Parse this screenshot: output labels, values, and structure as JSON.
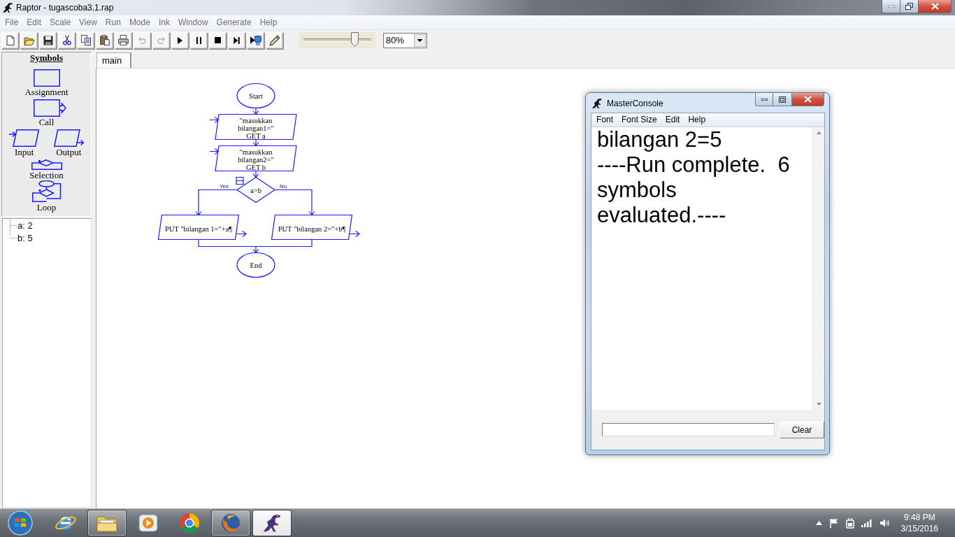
{
  "window": {
    "title": "Raptor - tugascoba3.1.rap"
  },
  "menu_bar": [
    "File",
    "Edit",
    "Scale",
    "View",
    "Run",
    "Mode",
    "Ink",
    "Window",
    "Generate",
    "Help"
  ],
  "toolbar": {
    "buttons": [
      {
        "kind": "new",
        "disabled": false
      },
      {
        "kind": "open",
        "disabled": false
      },
      {
        "kind": "save",
        "disabled": false
      },
      {
        "kind": "cut",
        "disabled": false
      },
      {
        "kind": "copy",
        "disabled": false
      },
      {
        "kind": "paste",
        "disabled": false
      },
      {
        "kind": "print",
        "disabled": false
      },
      {
        "kind": "undo",
        "disabled": true
      },
      {
        "kind": "redo",
        "disabled": true
      },
      {
        "kind": "play",
        "disabled": false
      },
      {
        "kind": "pause",
        "disabled": false
      },
      {
        "kind": "stop",
        "disabled": false
      },
      {
        "kind": "step",
        "disabled": false
      },
      {
        "kind": "run-complete",
        "disabled": false
      },
      {
        "kind": "pen",
        "disabled": false
      }
    ],
    "speed_slider": {
      "level": 0.75
    },
    "zoom": {
      "value": "80%"
    }
  },
  "symbols_panel": {
    "title": "Symbols",
    "symbols": [
      {
        "kind": "assignment",
        "label": "Assignment"
      },
      {
        "kind": "call",
        "label": "Call"
      },
      {
        "kind": "input",
        "label": "Input"
      },
      {
        "kind": "output",
        "label": "Output"
      },
      {
        "kind": "selection",
        "label": "Selection"
      },
      {
        "kind": "loop",
        "label": "Loop"
      }
    ]
  },
  "variables": [
    {
      "text": "a: 2"
    },
    {
      "text": "b: 5"
    }
  ],
  "tabs": [
    {
      "label": "main",
      "selected": true
    }
  ],
  "flowchart": {
    "nodes": [
      {
        "kind": "terminal",
        "lines": [
          "Start"
        ]
      },
      {
        "kind": "input",
        "lines": [
          "\"masukkan",
          "bilangan1=\"",
          "GET a"
        ]
      },
      {
        "kind": "input",
        "lines": [
          "\"masukkan",
          "bilangan2=\"",
          "GET b"
        ]
      },
      {
        "kind": "selection",
        "lines": [
          "a>b"
        ],
        "yes_label": "Yes",
        "no_label": "No",
        "expanded": true,
        "yes_branch": [
          {
            "kind": "output",
            "lines": [
              "PUT \"bilangan 1=\"+a¶"
            ]
          }
        ],
        "no_branch": [
          {
            "kind": "output",
            "lines": [
              "PUT \"bilangan 2=\"+b¶"
            ]
          }
        ]
      },
      {
        "kind": "terminal",
        "lines": [
          "End"
        ]
      }
    ]
  },
  "console": {
    "title": "MasterConsole",
    "menu": [
      "Font",
      "Font Size",
      "Edit",
      "Help"
    ],
    "output": [
      "bilangan 2=5",
      "----Run complete.  6 symbols evaluated.----"
    ],
    "clear_button": "Clear"
  },
  "taskbar": {
    "apps": [
      {
        "kind": "globe",
        "running": false,
        "selected": false
      },
      {
        "kind": "folder",
        "running": true,
        "selected": false
      },
      {
        "kind": "media",
        "running": false,
        "selected": false
      },
      {
        "kind": "wheel",
        "running": false,
        "selected": false
      },
      {
        "kind": "fox",
        "running": true,
        "selected": false
      },
      {
        "kind": "dinosaur",
        "running": true,
        "selected": true
      }
    ],
    "clock": {
      "time": "9:48 PM",
      "date": "3/15/2016"
    }
  }
}
